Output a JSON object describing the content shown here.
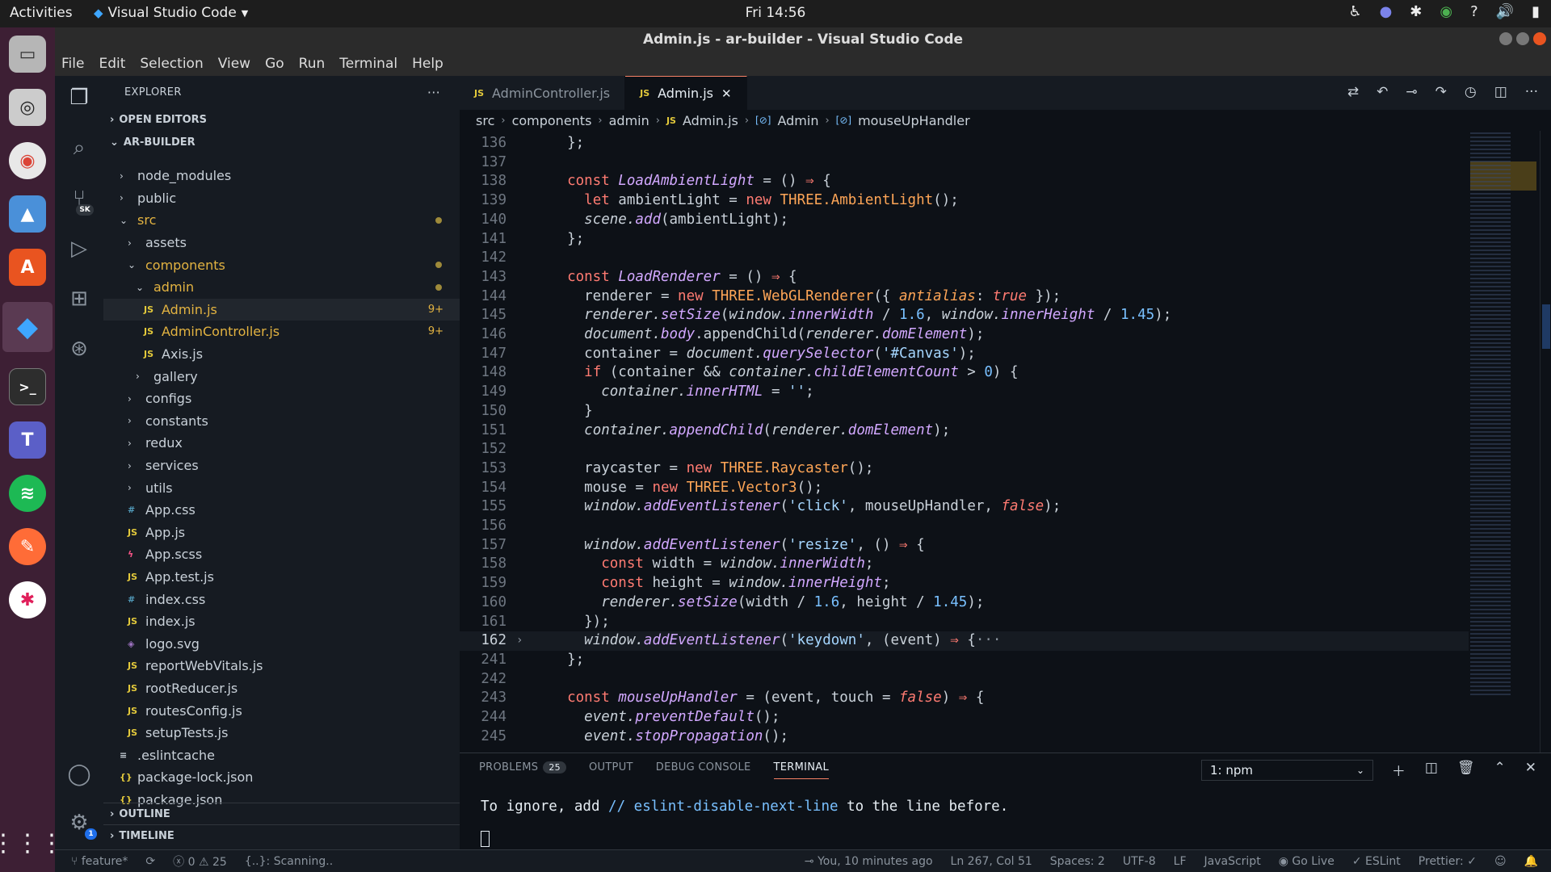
{
  "topbar": {
    "activities": "Activities",
    "app_name": "Visual Studio Code",
    "clock": "Fri 14:56",
    "tray": [
      "accessibility-icon",
      "teams-icon",
      "slack-icon",
      "chrome-icon",
      "help-icon",
      "volume-icon",
      "battery-icon"
    ]
  },
  "window": {
    "title": "Admin.js - ar-builder - Visual Studio Code"
  },
  "menu": [
    "File",
    "Edit",
    "Selection",
    "View",
    "Go",
    "Run",
    "Terminal",
    "Help"
  ],
  "activity": {
    "badge_scm": "SK",
    "badge_settings": "1"
  },
  "explorer": {
    "title": "EXPLORER",
    "open_editors": "OPEN EDITORS",
    "root": "AR-BUILDER",
    "tree": [
      {
        "label": "node_modules",
        "indent": 1,
        "type": "folder",
        "open": false
      },
      {
        "label": "public",
        "indent": 1,
        "type": "folder",
        "open": false
      },
      {
        "label": "src",
        "indent": 1,
        "type": "folder",
        "open": true,
        "mod": true,
        "dot": true
      },
      {
        "label": "assets",
        "indent": 2,
        "type": "folder",
        "open": false
      },
      {
        "label": "components",
        "indent": 2,
        "type": "folder",
        "open": true,
        "mod": true,
        "dot": true
      },
      {
        "label": "admin",
        "indent": 3,
        "type": "folder",
        "open": true,
        "mod": true,
        "dot": true
      },
      {
        "label": "Admin.js",
        "indent": 4,
        "type": "js",
        "mod": true,
        "dec": "9+",
        "selected": true
      },
      {
        "label": "AdminController.js",
        "indent": 4,
        "type": "js",
        "mod": true,
        "dec": "9+"
      },
      {
        "label": "Axis.js",
        "indent": 4,
        "type": "js"
      },
      {
        "label": "gallery",
        "indent": 3,
        "type": "folder",
        "open": false
      },
      {
        "label": "configs",
        "indent": 2,
        "type": "folder",
        "open": false
      },
      {
        "label": "constants",
        "indent": 2,
        "type": "folder",
        "open": false
      },
      {
        "label": "redux",
        "indent": 2,
        "type": "folder",
        "open": false
      },
      {
        "label": "services",
        "indent": 2,
        "type": "folder",
        "open": false
      },
      {
        "label": "utils",
        "indent": 2,
        "type": "folder",
        "open": false
      },
      {
        "label": "App.css",
        "indent": 2,
        "type": "css"
      },
      {
        "label": "App.js",
        "indent": 2,
        "type": "js"
      },
      {
        "label": "App.scss",
        "indent": 2,
        "type": "scss"
      },
      {
        "label": "App.test.js",
        "indent": 2,
        "type": "js"
      },
      {
        "label": "index.css",
        "indent": 2,
        "type": "css"
      },
      {
        "label": "index.js",
        "indent": 2,
        "type": "js"
      },
      {
        "label": "logo.svg",
        "indent": 2,
        "type": "svg"
      },
      {
        "label": "reportWebVitals.js",
        "indent": 2,
        "type": "js"
      },
      {
        "label": "rootReducer.js",
        "indent": 2,
        "type": "js"
      },
      {
        "label": "routesConfig.js",
        "indent": 2,
        "type": "js"
      },
      {
        "label": "setupTests.js",
        "indent": 2,
        "type": "js"
      },
      {
        "label": ".eslintcache",
        "indent": 1,
        "type": "txt"
      },
      {
        "label": "package-lock.json",
        "indent": 1,
        "type": "json"
      },
      {
        "label": "package.json",
        "indent": 1,
        "type": "json"
      }
    ],
    "outline": "OUTLINE",
    "timeline": "TIMELINE"
  },
  "tabs": [
    {
      "label": "AdminController.js",
      "active": false
    },
    {
      "label": "Admin.js",
      "active": true
    }
  ],
  "breadcrumb": [
    "src",
    "components",
    "admin",
    "Admin.js",
    "Admin",
    "mouseUpHandler"
  ],
  "code_lines": [
    {
      "n": "136",
      "t": "  };"
    },
    {
      "n": "137",
      "t": ""
    },
    {
      "n": "138",
      "t": "  const LoadAmbientLight = () ⇒ {"
    },
    {
      "n": "139",
      "t": "    let ambientLight = new THREE.AmbientLight();"
    },
    {
      "n": "140",
      "t": "    scene.add(ambientLight);"
    },
    {
      "n": "141",
      "t": "  };"
    },
    {
      "n": "142",
      "t": ""
    },
    {
      "n": "143",
      "t": "  const LoadRenderer = () ⇒ {"
    },
    {
      "n": "144",
      "t": "    renderer = new THREE.WebGLRenderer({ antialias: true });"
    },
    {
      "n": "145",
      "t": "    renderer.setSize(window.innerWidth / 1.6, window.innerHeight / 1.45);"
    },
    {
      "n": "146",
      "t": "    document.body.appendChild(renderer.domElement);"
    },
    {
      "n": "147",
      "t": "    container = document.querySelector('#Canvas');"
    },
    {
      "n": "148",
      "t": "    if (container && container.childElementCount > 0) {"
    },
    {
      "n": "149",
      "t": "      container.innerHTML = '';"
    },
    {
      "n": "150",
      "t": "    }"
    },
    {
      "n": "151",
      "t": "    container.appendChild(renderer.domElement);"
    },
    {
      "n": "152",
      "t": ""
    },
    {
      "n": "153",
      "t": "    raycaster = new THREE.Raycaster();"
    },
    {
      "n": "154",
      "t": "    mouse = new THREE.Vector3();"
    },
    {
      "n": "155",
      "t": "    window.addEventListener('click', mouseUpHandler, false);"
    },
    {
      "n": "156",
      "t": ""
    },
    {
      "n": "157",
      "t": "    window.addEventListener('resize', () ⇒ {"
    },
    {
      "n": "158",
      "t": "      const width = window.innerWidth;"
    },
    {
      "n": "159",
      "t": "      const height = window.innerHeight;"
    },
    {
      "n": "160",
      "t": "      renderer.setSize(width / 1.6, height / 1.45);"
    },
    {
      "n": "161",
      "t": "    });"
    },
    {
      "n": "162",
      "t": "    window.addEventListener('keydown', (event) ⇒ {···",
      "fold": true,
      "current": true
    },
    {
      "n": "241",
      "t": "  };"
    },
    {
      "n": "242",
      "t": ""
    },
    {
      "n": "243",
      "t": "  const mouseUpHandler = (event, touch = false) ⇒ {"
    },
    {
      "n": "244",
      "t": "    event.preventDefault();"
    },
    {
      "n": "245",
      "t": "    event.stopPropagation();"
    }
  ],
  "panel": {
    "tabs": [
      "PROBLEMS",
      "OUTPUT",
      "DEBUG CONSOLE",
      "TERMINAL"
    ],
    "problems_count": "25",
    "terminal_select": "1: npm",
    "terminal_text_a": "To ignore, add ",
    "terminal_text_b": "// eslint-disable-next-line",
    "terminal_text_c": " to the line before."
  },
  "status": {
    "branch": "feature*",
    "errors": "0",
    "warnings": "25",
    "scanning": "{..}: Scanning..",
    "blame": "You, 10 minutes ago",
    "position": "Ln 267, Col 51",
    "spaces": "Spaces: 2",
    "encoding": "UTF-8",
    "eol": "LF",
    "language": "JavaScript",
    "golive": "Go Live",
    "eslint": "ESLint",
    "prettier": "Prettier: ✓"
  },
  "colors": {
    "accent": "#f78166",
    "modified": "#e3b341",
    "background": "#0d1117",
    "sidebar": "#161b22"
  }
}
